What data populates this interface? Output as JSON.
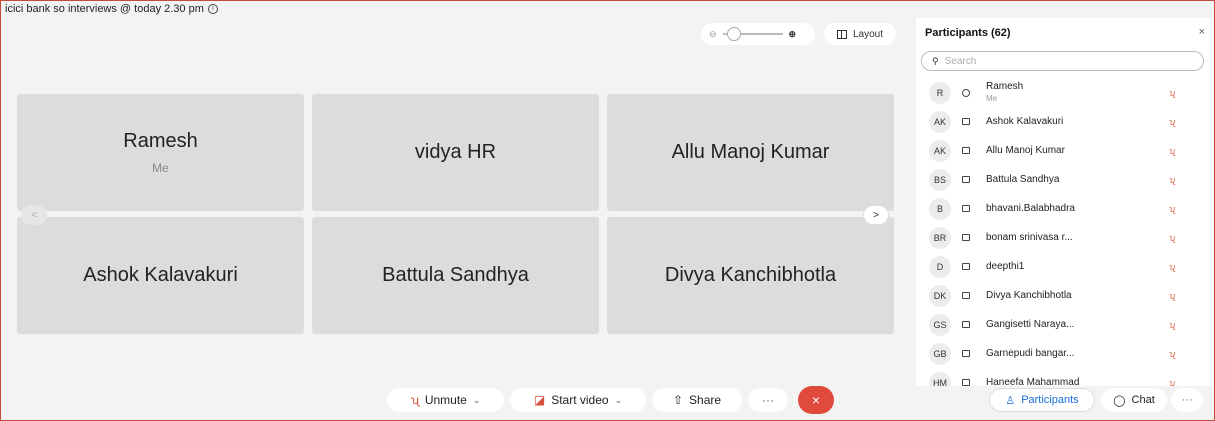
{
  "meeting": {
    "title": "icici bank so interviews @ today 2.30 pm",
    "info_icon": "i"
  },
  "top_controls": {
    "layout_label": "Layout"
  },
  "tiles": [
    {
      "name": "Ramesh",
      "sub": "Me"
    },
    {
      "name": "vidya HR",
      "sub": ""
    },
    {
      "name": "Allu Manoj Kumar",
      "sub": ""
    },
    {
      "name": "Ashok Kalavakuri",
      "sub": ""
    },
    {
      "name": "Battula Sandhya",
      "sub": ""
    },
    {
      "name": "Divya Kanchibhotla",
      "sub": ""
    }
  ],
  "panel": {
    "title": "Participants (62)",
    "close": "×",
    "search_placeholder": "Search",
    "participants": [
      {
        "initials": "R",
        "name": "Ramesh",
        "sub": "Me",
        "device": "headset"
      },
      {
        "initials": "AK",
        "name": "Ashok Kalavakuri",
        "sub": "",
        "device": "phone"
      },
      {
        "initials": "AK",
        "name": "Allu Manoj Kumar",
        "sub": "",
        "device": "phone"
      },
      {
        "initials": "BS",
        "name": "Battula Sandhya",
        "sub": "",
        "device": "phone"
      },
      {
        "initials": "B",
        "name": "bhavani.Balabhadra",
        "sub": "",
        "device": "phone"
      },
      {
        "initials": "BR",
        "name": "bonam srinivasa r...",
        "sub": "",
        "device": "phone"
      },
      {
        "initials": "D",
        "name": "deepthi1",
        "sub": "",
        "device": "phone"
      },
      {
        "initials": "DK",
        "name": "Divya Kanchibhotla",
        "sub": "",
        "device": "phone"
      },
      {
        "initials": "GS",
        "name": "Gangisetti Naraya...",
        "sub": "",
        "device": "phone"
      },
      {
        "initials": "GB",
        "name": "Garnepudi bangar...",
        "sub": "",
        "device": "phone"
      },
      {
        "initials": "HM",
        "name": "Haneefa Mahammad",
        "sub": "",
        "device": "phone"
      }
    ]
  },
  "toolbar": {
    "unmute": "Unmute",
    "start_video": "Start video",
    "share": "Share",
    "more": "···",
    "end": "×",
    "participants": "Participants",
    "chat": "Chat",
    "overflow": "···"
  },
  "colors": {
    "accent": "#1a6fd6",
    "danger": "#e04a3a",
    "border": "#c64a3c"
  }
}
